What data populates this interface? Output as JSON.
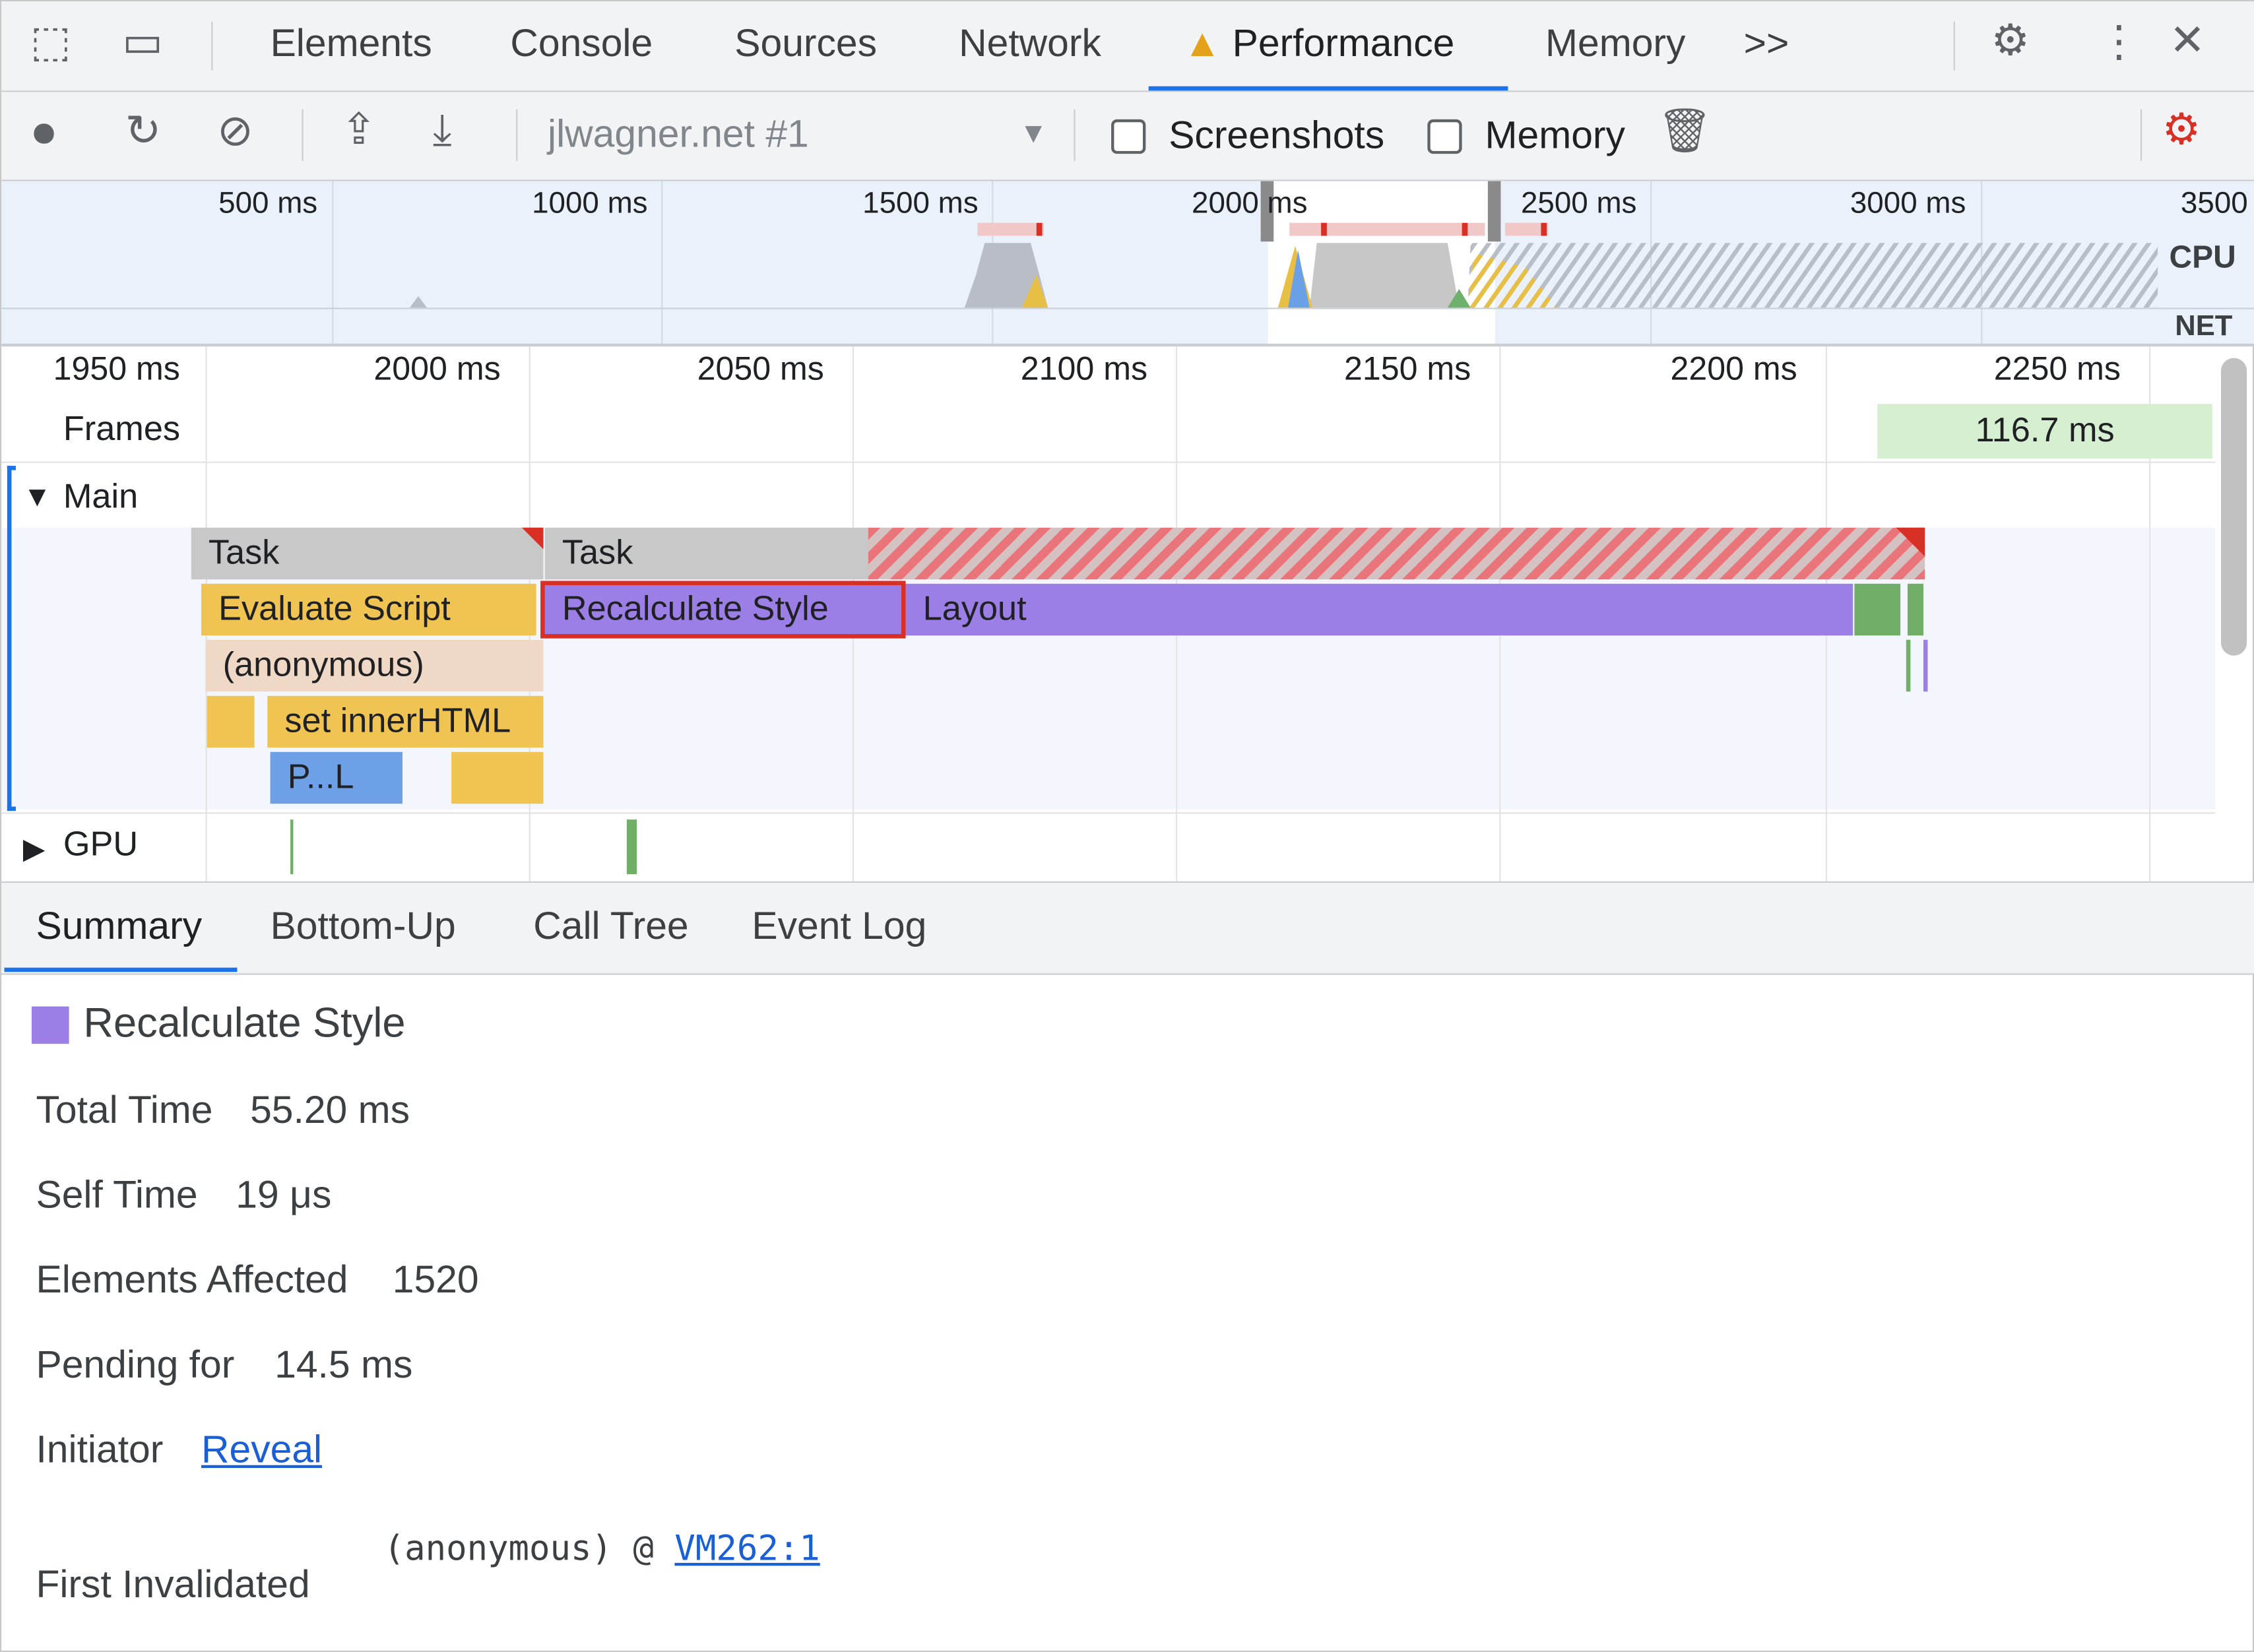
{
  "tabs": {
    "items": [
      "Elements",
      "Console",
      "Sources",
      "Network",
      "Performance",
      "Memory"
    ],
    "active": "Performance",
    "more": ">>"
  },
  "toolbar": {
    "profile": "jlwagner.net #1",
    "screenshots_label": "Screenshots",
    "screenshots_checked": false,
    "memory_label": "Memory",
    "memory_checked": false
  },
  "overview": {
    "ticks": [
      "500 ms",
      "1000 ms",
      "1500 ms",
      "2000 ms",
      "2500 ms",
      "3000 ms",
      "3500"
    ],
    "cpu_label": "CPU",
    "net_label": "NET"
  },
  "timeline": {
    "ticks": [
      "1950 ms",
      "2000 ms",
      "2050 ms",
      "2100 ms",
      "2150 ms",
      "2200 ms",
      "2250 ms"
    ],
    "frames_label": "Frames",
    "frame_duration": "116.7 ms",
    "main_label": "Main",
    "gpu_label": "GPU",
    "events": {
      "task1": "Task",
      "task2": "Task",
      "evaluate": "Evaluate Script",
      "recalc": "Recalculate Style",
      "layout": "Layout",
      "anon": "(anonymous)",
      "innerhtml": "set innerHTML",
      "parse": "P...L"
    }
  },
  "bottom_tabs": [
    "Summary",
    "Bottom-Up",
    "Call Tree",
    "Event Log"
  ],
  "summary": {
    "title": "Recalculate Style",
    "color": "#9b7fe6",
    "total_time_label": "Total Time",
    "total_time": "55.20 ms",
    "self_time_label": "Self Time",
    "self_time": "19 μs",
    "elements_label": "Elements Affected",
    "elements": "1520",
    "pending_label": "Pending for",
    "pending": "14.5 ms",
    "initiator_label": "Initiator",
    "initiator_link": "Reveal",
    "first_invalidated_label": "First Invalidated",
    "first_invalidated_fn": "(anonymous) @ ",
    "first_invalidated_link": "VM262:1"
  }
}
